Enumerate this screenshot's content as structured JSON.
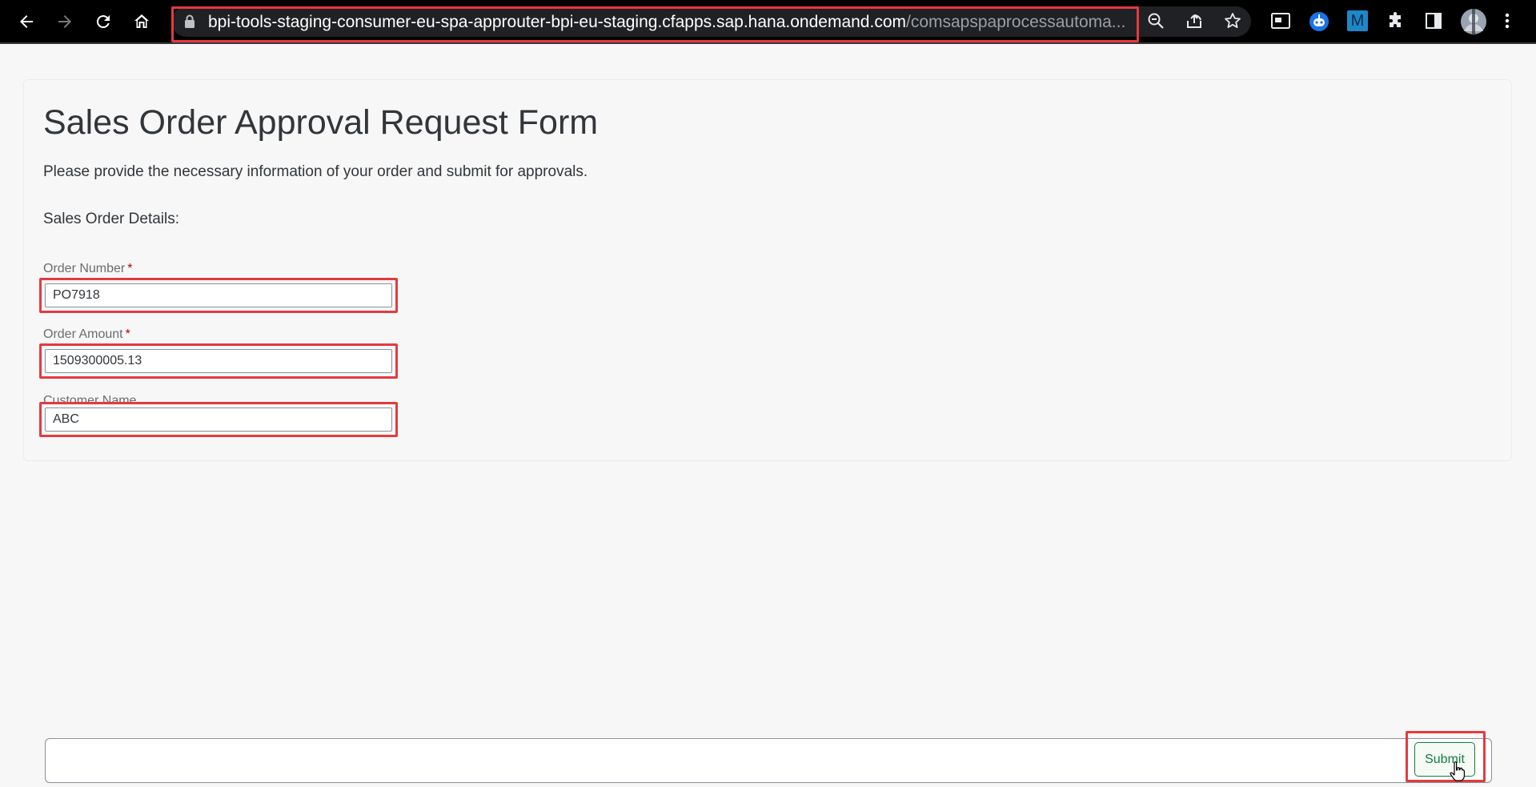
{
  "browser": {
    "url_host": "bpi-tools-staging-consumer-eu-spa-approuter-bpi-eu-staging.cfapps.sap.hana.ondemand.com",
    "url_path": "/comsapspaprocessautoma...",
    "icons": [
      "back-icon",
      "forward-icon",
      "reload-icon",
      "home-icon",
      "lock-icon",
      "zoom-icon",
      "share-icon",
      "bookmark-star-icon",
      "tab-search-icon",
      "robot-extension-icon",
      "m-extension-icon",
      "puzzle-extensions-icon",
      "side-panel-icon",
      "profile-avatar",
      "menu-kebab-icon"
    ],
    "extension_m_label": "M"
  },
  "form": {
    "title": "Sales Order Approval Request Form",
    "description": "Please provide the necessary information of your order and submit for approvals.",
    "section_heading": "Sales Order Details:",
    "fields": [
      {
        "label": "Order Number",
        "value": "PO7918",
        "required": "*"
      },
      {
        "label": "Order Amount",
        "value": "1509300005.13",
        "required": "*"
      },
      {
        "label": "Customer Name",
        "value": "ABC"
      }
    ]
  },
  "footer": {
    "submit_label": "Submit"
  },
  "colors": {
    "highlight": "#e53a3f",
    "required": "#bb0000",
    "submit": "#107e3e"
  }
}
